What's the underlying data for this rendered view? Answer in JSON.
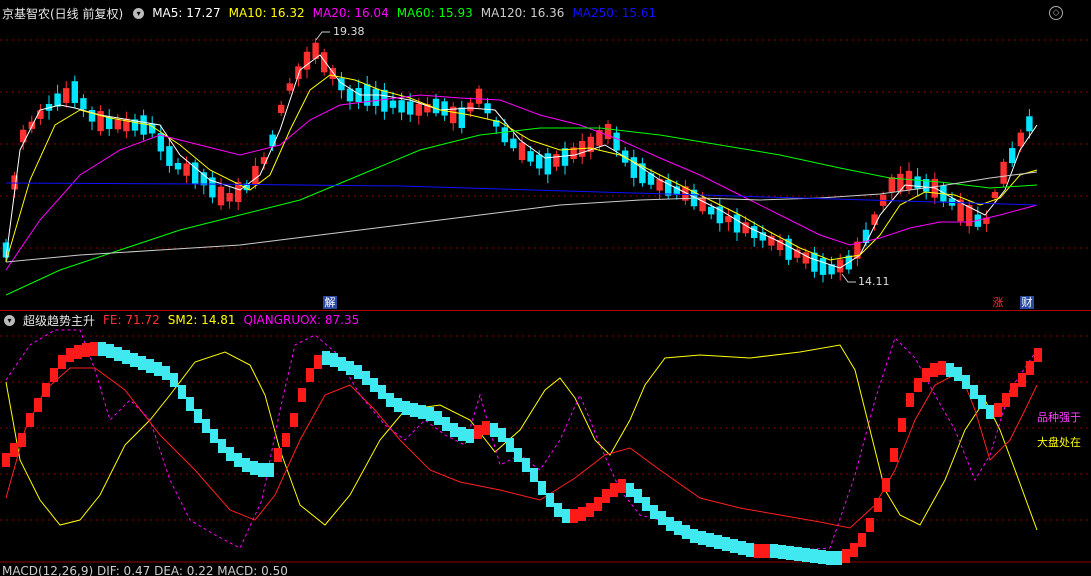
{
  "stock": {
    "title": "京基智农(日线 前复权)"
  },
  "main_indicators": [
    {
      "label": "MA5: 17.27",
      "color": "#ffffff"
    },
    {
      "label": "MA10: 16.32",
      "color": "#ffff00"
    },
    {
      "label": "MA20: 16.04",
      "color": "#ff00ff"
    },
    {
      "label": "MA60: 15.93",
      "color": "#00ff00"
    },
    {
      "label": "MA120: 16.36",
      "color": "#cccccc"
    },
    {
      "label": "MA250: 15.61",
      "color": "#0000ff"
    }
  ],
  "price_markers": {
    "high": "19.38",
    "low": "14.11"
  },
  "event_tags": {
    "jie": "解",
    "zhang": "涨",
    "cai": "财"
  },
  "sub_chart": {
    "title": "超级趋势主升",
    "indicators": [
      {
        "label": "FE: 71.72",
        "color": "#ff3030"
      },
      {
        "label": "SM2: 14.81",
        "color": "#ffff00"
      },
      {
        "label": "QIANGRUOX: 87.35",
        "color": "#ff00ff"
      }
    ],
    "right_labels": {
      "pinzhong": "品种强于",
      "dapan": "大盘处在"
    }
  },
  "macd": {
    "label": "MACD(12,26,9)  DIF: 0.47  DEA: 0.22  MACD: 0.50"
  },
  "colors": {
    "up": "#ff3030",
    "down": "#00e5ff",
    "grid": "#8b0000",
    "bg": "#000000"
  }
}
